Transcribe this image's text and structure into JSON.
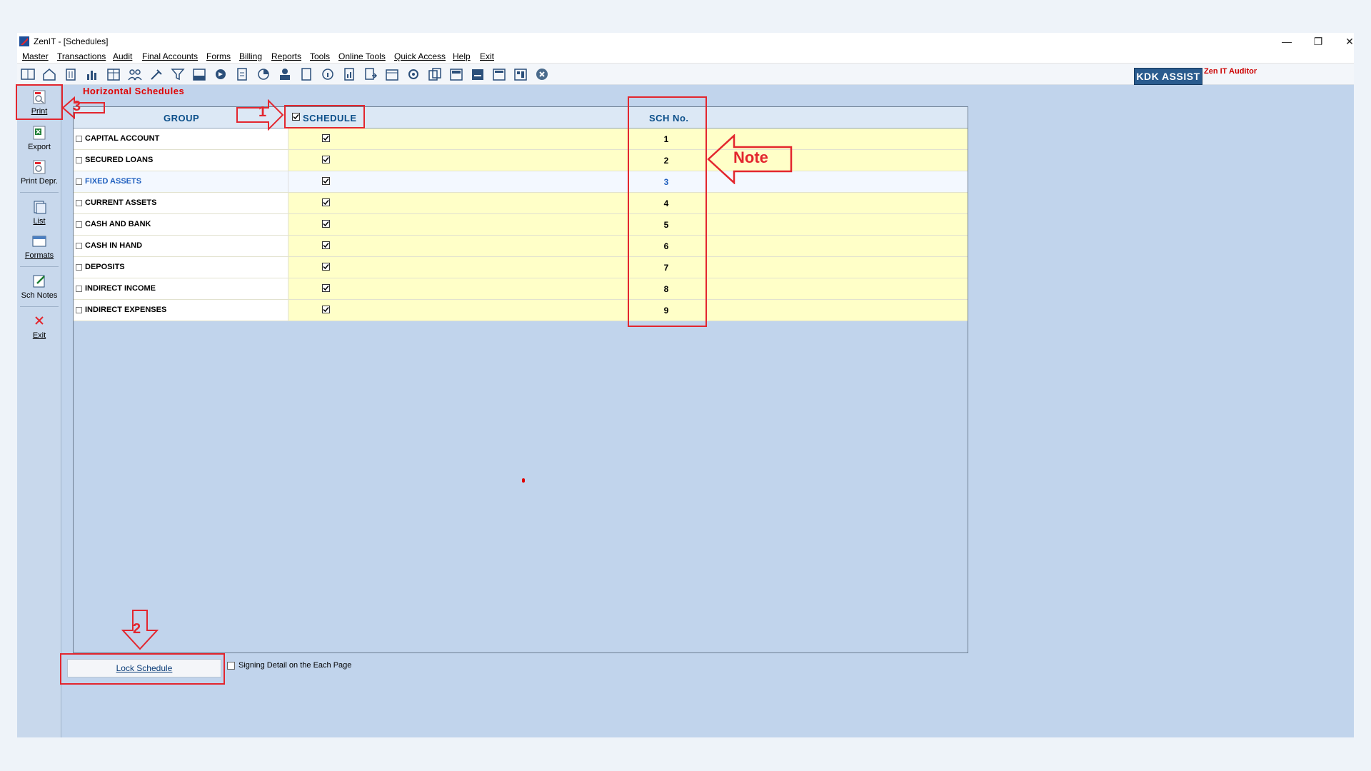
{
  "window": {
    "title": "ZenIT - [Schedules]",
    "minimize": "—",
    "restore": "❐",
    "close": "✕"
  },
  "menu": [
    {
      "label": "Master"
    },
    {
      "label": "Transactions"
    },
    {
      "label": "Audit"
    },
    {
      "label": "Final Accounts"
    },
    {
      "label": "Forms"
    },
    {
      "label": "Billing"
    },
    {
      "label": "Reports"
    },
    {
      "label": "Tools"
    },
    {
      "label": "Online Tools"
    },
    {
      "label": "Quick Access"
    },
    {
      "label": "Help"
    },
    {
      "label": "Exit"
    }
  ],
  "toolbar": {
    "icons": [
      "open-book-icon",
      "home-icon",
      "building-icon",
      "bar-chart-icon",
      "calendar-grid-icon",
      "people-icon",
      "tools-icon",
      "filter-icon",
      "tax-icon",
      "toggle-icon",
      "calculator-icon",
      "pie-icon",
      "pay-icon",
      "document-icon",
      "info-icon",
      "report-icon",
      "export-doc-icon",
      "calendar-icon",
      "settings-icon",
      "copy-icon",
      "bs-icon",
      "bs2-icon",
      "tdo-icon",
      "grid-doc-icon",
      "close-circle-icon"
    ],
    "kdk_assist": "KDK ASSIST",
    "zen_auditor": "Zen IT Auditor"
  },
  "sidebar": [
    {
      "label": "Print",
      "icon": "print-icon"
    },
    {
      "label": "Export",
      "icon": "excel-icon"
    },
    {
      "label": "Print Depr.",
      "icon": "print-depr-icon"
    },
    {
      "label": "List",
      "icon": "list-icon"
    },
    {
      "label": "Formats",
      "icon": "formats-icon"
    },
    {
      "label": "Sch Notes",
      "icon": "notes-icon"
    },
    {
      "label": "Exit",
      "icon": "exit-x-icon"
    }
  ],
  "section_title": "Horizontal Schedules",
  "grid": {
    "headers": {
      "group": "GROUP",
      "schedule": "SCHEDULE",
      "sch_no": "SCH No."
    },
    "rows": [
      {
        "group": "CAPITAL ACCOUNT",
        "schedule": true,
        "sch_no": "1"
      },
      {
        "group": "SECURED LOANS",
        "schedule": true,
        "sch_no": "2"
      },
      {
        "group": "FIXED ASSETS",
        "schedule": true,
        "sch_no": "3",
        "selected": true
      },
      {
        "group": "CURRENT ASSETS",
        "schedule": true,
        "sch_no": "4"
      },
      {
        "group": "CASH AND BANK",
        "schedule": true,
        "sch_no": "5"
      },
      {
        "group": "CASH IN HAND",
        "schedule": true,
        "sch_no": "6"
      },
      {
        "group": "DEPOSITS",
        "schedule": true,
        "sch_no": "7"
      },
      {
        "group": "INDIRECT INCOME",
        "schedule": true,
        "sch_no": "8"
      },
      {
        "group": "INDIRECT EXPENSES",
        "schedule": true,
        "sch_no": "9"
      }
    ]
  },
  "footer": {
    "lock_button": "Lock Schedule",
    "signing_label": "Signing Detail on the Each Page",
    "signing_checked": false
  },
  "annotations": {
    "one": "1",
    "two": "2",
    "three": "3",
    "note": "Note"
  },
  "colors": {
    "accent_red": "#e3262e",
    "header_blue": "#0b4f8a",
    "row_yellow": "#ffffc8",
    "background": "#c1d4ec"
  }
}
